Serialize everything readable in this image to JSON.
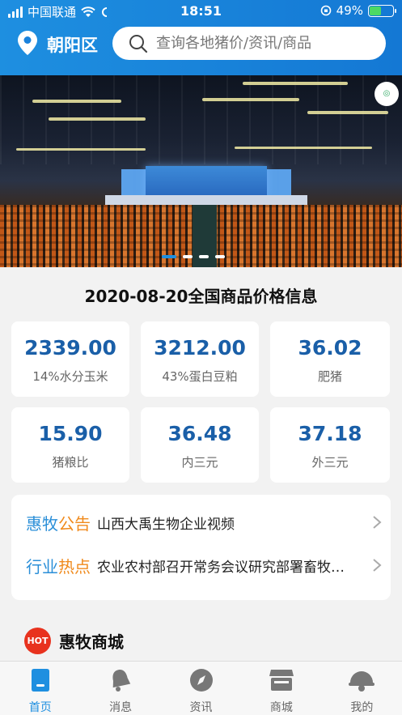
{
  "status_bar": {
    "carrier": "中国联通",
    "time": "18:51",
    "battery": "49%"
  },
  "nav": {
    "location": "朝阳区",
    "search_placeholder": "查询各地猪价/资讯/商品"
  },
  "banner": {
    "slide_count": 4,
    "active_index": 0
  },
  "prices": {
    "title": "2020-08-20全国商品价格信息",
    "items": [
      {
        "value": "2339.00",
        "label": "14%水分玉米"
      },
      {
        "value": "3212.00",
        "label": "43%蛋白豆粕"
      },
      {
        "value": "36.02",
        "label": "肥猪"
      },
      {
        "value": "15.90",
        "label": "猪粮比"
      },
      {
        "value": "36.48",
        "label": "内三元"
      },
      {
        "value": "37.18",
        "label": "外三元"
      }
    ]
  },
  "notices": [
    {
      "tag_a": "惠牧",
      "tag_b": "公告",
      "text": "山西大禹生物企业视频"
    },
    {
      "tag_a": "行业",
      "tag_b": "热点",
      "text": "农业农村部召开常务会议研究部署畜牧业发展"
    }
  ],
  "mall": {
    "badge": "HOT",
    "title": "惠牧商城"
  },
  "tabs": [
    {
      "label": "首页",
      "icon": "home-icon"
    },
    {
      "label": "消息",
      "icon": "bell-icon"
    },
    {
      "label": "资讯",
      "icon": "compass-icon"
    },
    {
      "label": "商城",
      "icon": "store-icon"
    },
    {
      "label": "我的",
      "icon": "helmet-icon"
    }
  ],
  "colors": {
    "brand_blue": "#1e8fe0",
    "value_blue": "#1a5fa8",
    "accent_orange": "#f08a1c"
  }
}
